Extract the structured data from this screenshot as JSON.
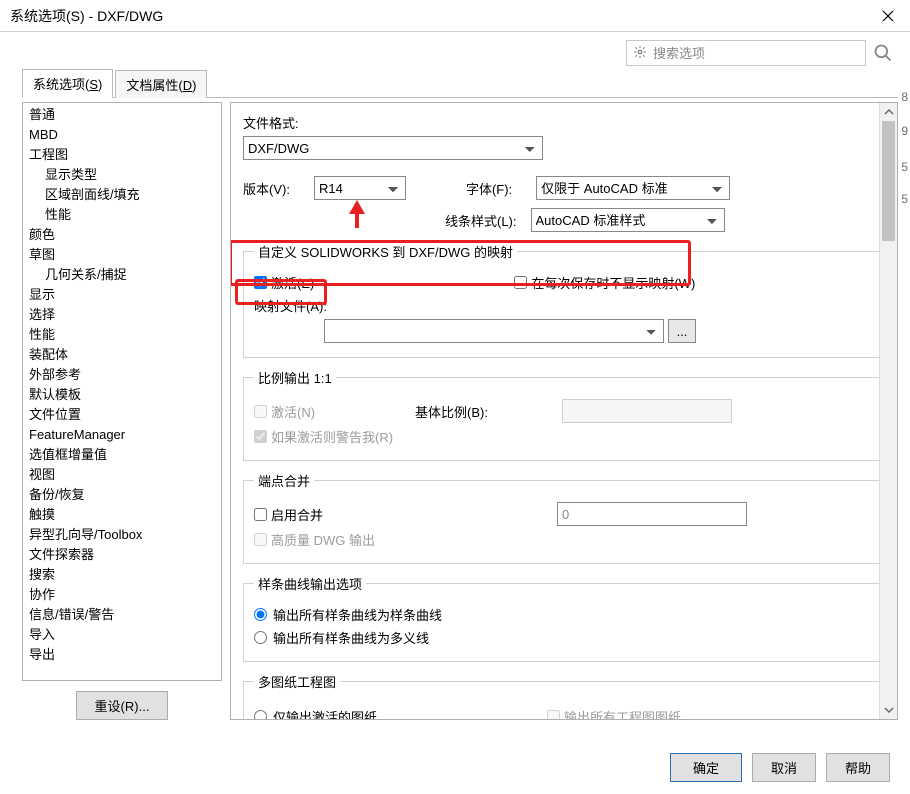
{
  "titlebar": {
    "title": "系统选项(S) - DXF/DWG"
  },
  "search": {
    "placeholder": "搜索选项"
  },
  "tabs": {
    "system": "系统选项(",
    "system_hot": "S",
    "system_end": ")",
    "doc": "文档属性(",
    "doc_hot": "D",
    "doc_end": ")"
  },
  "tree": {
    "items": [
      "普通",
      "MBD",
      "工程图",
      "显示类型",
      "区域剖面线/填充",
      "性能",
      "颜色",
      "草图",
      "几何关系/捕捉",
      "显示",
      "选择",
      "性能",
      "装配体",
      "外部参考",
      "默认模板",
      "文件位置",
      "FeatureManager",
      "选值框增量值",
      "视图",
      "备份/恢复",
      "触摸",
      "异型孔向导/Toolbox",
      "文件探索器",
      "搜索",
      "协作",
      "信息/错误/警告",
      "导入",
      "导出"
    ]
  },
  "buttons": {
    "reset": "重设(R)...",
    "ok": "确定",
    "cancel": "取消",
    "help": "帮助",
    "browse": "..."
  },
  "right": {
    "fileformat_label": "文件格式:",
    "fileformat_value": "DXF/DWG",
    "version_label": "版本(V):",
    "version_value": "R14",
    "font_label": "字体(F):",
    "font_value": "仅限于 AutoCAD 标准",
    "linestyle_label": "线条样式(L):",
    "linestyle_value": "AutoCAD 标准样式",
    "mapping_legend": "自定义 SOLIDWORKS 到 DXF/DWG 的映射",
    "mapping_activate": "激活(E)",
    "mapping_noshow": "在每次保存时不显示映射(W)",
    "mapping_file_label": "映射文件(A):",
    "scale_legend": "比例输出 1:1",
    "scale_activate": "激活(N)",
    "scale_base_label": "基体比例(B):",
    "scale_warn": "如果激活则警告我(R)",
    "endpoint_legend": "端点合并",
    "endpoint_enable": "启用合并",
    "endpoint_value": "0",
    "endpoint_hq": "高质量 DWG 输出",
    "spline_legend": "样条曲线输出选项",
    "spline_opt1": "输出所有样条曲线为样条曲线",
    "spline_opt2": "输出所有样条曲线为多义线",
    "multisheet_legend": "多图纸工程图",
    "multisheet_opt1": "仅输出激活的图纸",
    "multisheet_chk": "输出所有工程图图纸"
  },
  "bg": {
    "n1": "8",
    "n2": "9",
    "n3": "5",
    "n4": "5"
  }
}
